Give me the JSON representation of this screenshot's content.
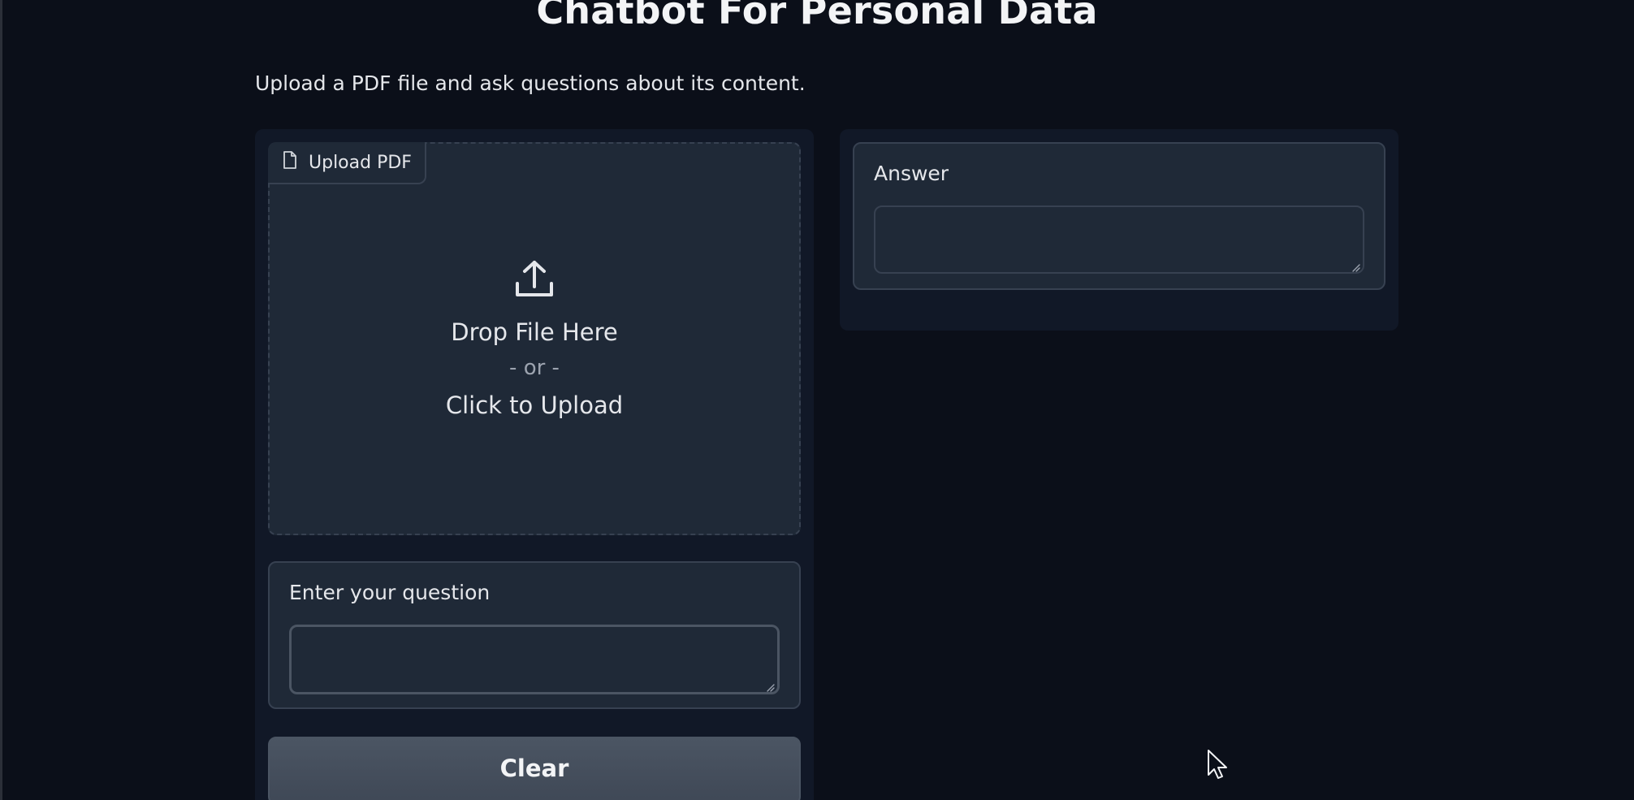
{
  "header": {
    "title": "Chatbot For Personal Data",
    "description": "Upload a PDF file and ask questions about its content."
  },
  "upload": {
    "label": "Upload PDF",
    "label_icon": "file-icon",
    "upload_icon": "upload-icon",
    "drop_text": "Drop File Here",
    "or_text": "- or -",
    "click_text": "Click to Upload"
  },
  "question": {
    "label": "Enter your question",
    "value": ""
  },
  "answer": {
    "label": "Answer",
    "value": ""
  },
  "buttons": {
    "clear_label": "Clear"
  },
  "colors": {
    "background": "#0b0f19",
    "panel": "#111827",
    "block": "#1f2937",
    "border": "#374151",
    "button": "#4b5563"
  }
}
